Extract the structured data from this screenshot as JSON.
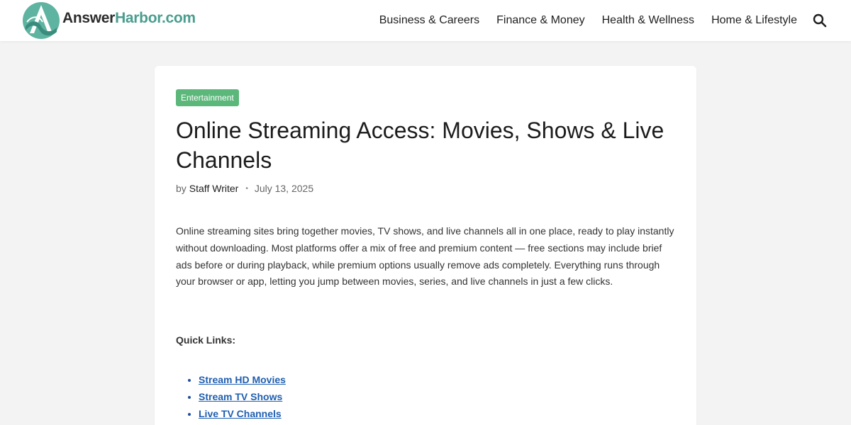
{
  "header": {
    "logo_text_a": "Answer",
    "logo_text_b": "Harbor.com",
    "nav": [
      {
        "label": "Business & Careers"
      },
      {
        "label": "Finance & Money"
      },
      {
        "label": "Health & Wellness"
      },
      {
        "label": "Home & Lifestyle"
      }
    ],
    "search_icon": "search-icon"
  },
  "article": {
    "category": "Entertainment",
    "title": "Online Streaming Access: Movies, Shows & Live Channels",
    "by_label": "by",
    "author": "Staff Writer",
    "separator": "•",
    "date": "July 13, 2025",
    "intro": "Online streaming sites bring together movies, TV shows, and live channels all in one place, ready to play instantly without downloading. Most platforms offer a mix of free and premium content — free sections may include brief ads before or during playback, while premium options usually remove ads completely. Everything runs through your browser or app, letting you jump between movies, series, and live channels in just a few clicks.",
    "quick_links_label": "Quick Links:",
    "quick_links": [
      {
        "label": "Stream HD Movies"
      },
      {
        "label": "Stream TV Shows"
      },
      {
        "label": "Live TV Channels"
      }
    ]
  },
  "colors": {
    "background": "#f3f3f3",
    "category_badge": "#5cb77a",
    "logo_accent": "#4a9d8f",
    "link": "#1f5fb0"
  }
}
